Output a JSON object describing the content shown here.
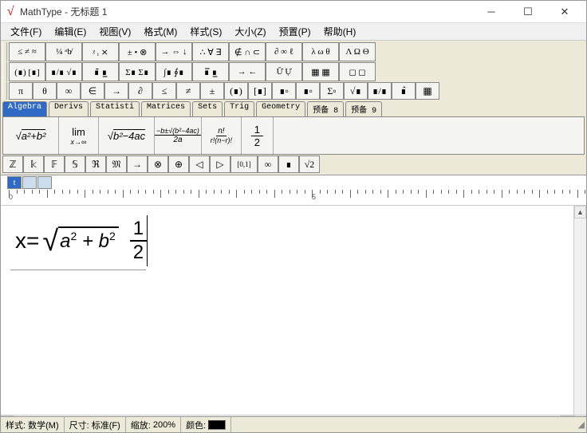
{
  "window": {
    "app": "MathType",
    "doc": "无标题 1",
    "sep": " - "
  },
  "menu": {
    "file": "文件(F)",
    "edit": "编辑(E)",
    "view": "视图(V)",
    "format": "格式(M)",
    "style": "样式(S)",
    "size": "大小(Z)",
    "prefs": "预置(P)",
    "help": "帮助(H)"
  },
  "palette": {
    "row1": [
      "≤ ≠ ≈",
      "¼ ᵃb̸",
      "ᵡ ᵢ ⨯",
      "± • ⊗",
      "→ ⇔ ↓",
      "∴ ∀ ∃",
      "∉ ∩ ⊂",
      "∂ ∞ ℓ",
      "λ ω θ",
      "Λ Ω Θ"
    ],
    "row2": [
      "(∎) [∎]",
      "∎/∎ √∎",
      "∎̄ ∎̲",
      "Σ∎ Σ∎",
      "∫∎ ∮∎",
      "∎̅ ∎̲",
      "→ ←",
      "Ū̇ Ụ̇",
      "▦ ▦",
      "◻ ◻"
    ],
    "row3": [
      "π",
      "θ",
      "∞",
      "∈",
      "→",
      "∂",
      "≤",
      "≠",
      "±",
      "(∎)",
      "[∎]",
      "∎▫",
      "∎▫",
      "Σ▫",
      "√∎",
      "∎/∎",
      "∎̂",
      "▦"
    ]
  },
  "tabs": [
    "Algebra",
    "Derivs",
    "Statisti",
    "Matrices",
    "Sets",
    "Trig",
    "Geometry",
    "预备 8",
    "预备 9"
  ],
  "templates": {
    "t1": "√(a²+b²)",
    "t2_top": "lim",
    "t2_bot": "x→∞",
    "t3": "√(b²−4ac)",
    "t4_top": "−b±√(b²−4ac)",
    "t4_bot": "2a",
    "t5_top": "n!",
    "t5_bot": "r!(n−r)!",
    "t6_top": "1",
    "t6_bot": "2"
  },
  "symrow": [
    "ℤ",
    "𝕜",
    "𝔽",
    "𝕊",
    "ℜ",
    "𝔐",
    "→",
    "⊗",
    "⊕",
    "◁",
    "▷",
    "[0,1]",
    "∞",
    "∎",
    "√2"
  ],
  "ruler": {
    "marks": [
      "0",
      "5"
    ]
  },
  "equation": {
    "lhs": "x=",
    "rad": "a",
    "exp1": "2",
    "plus": " + ",
    "rad2": "b",
    "exp2": "2",
    "num": "1",
    "den": "2"
  },
  "status": {
    "style_l": "样式:",
    "style_v": "数学(M)",
    "size_l": "尺寸:",
    "size_v": "标准(F)",
    "zoom_l": "缩放:",
    "zoom_v": "200%",
    "color_l": "颜色:"
  }
}
